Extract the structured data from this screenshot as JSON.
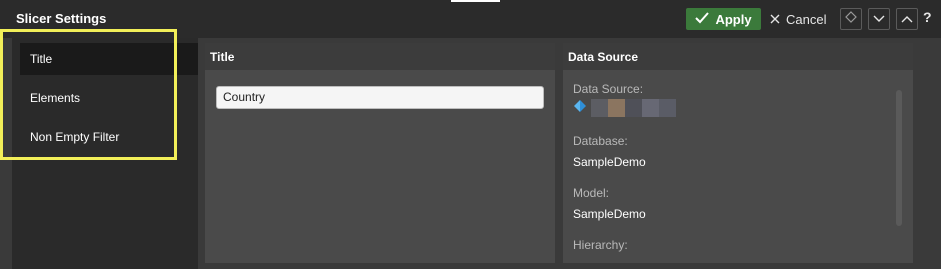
{
  "app": {
    "title": "Slicer Settings"
  },
  "toolbar": {
    "apply_label": "Apply",
    "cancel_label": "Cancel",
    "help_label": "?"
  },
  "sidebar": {
    "items": [
      {
        "label": "Title",
        "selected": true
      },
      {
        "label": "Elements",
        "selected": false
      },
      {
        "label": "Non Empty Filter",
        "selected": false
      }
    ]
  },
  "title_panel": {
    "header": "Title",
    "title_value": "Country"
  },
  "data_source_panel": {
    "header": "Data Source",
    "data_source_label": "Data Source:",
    "database_label": "Database:",
    "database_value": "SampleDemo",
    "model_label": "Model:",
    "model_value": "SampleDemo",
    "hierarchy_label": "Hierarchy:"
  },
  "colors": {
    "accent_green": "#3b7a3b",
    "highlight_yellow": "#f2ef59",
    "sidebar_bg": "#2a2a2a",
    "panel_bg": "#4a4a4a"
  }
}
